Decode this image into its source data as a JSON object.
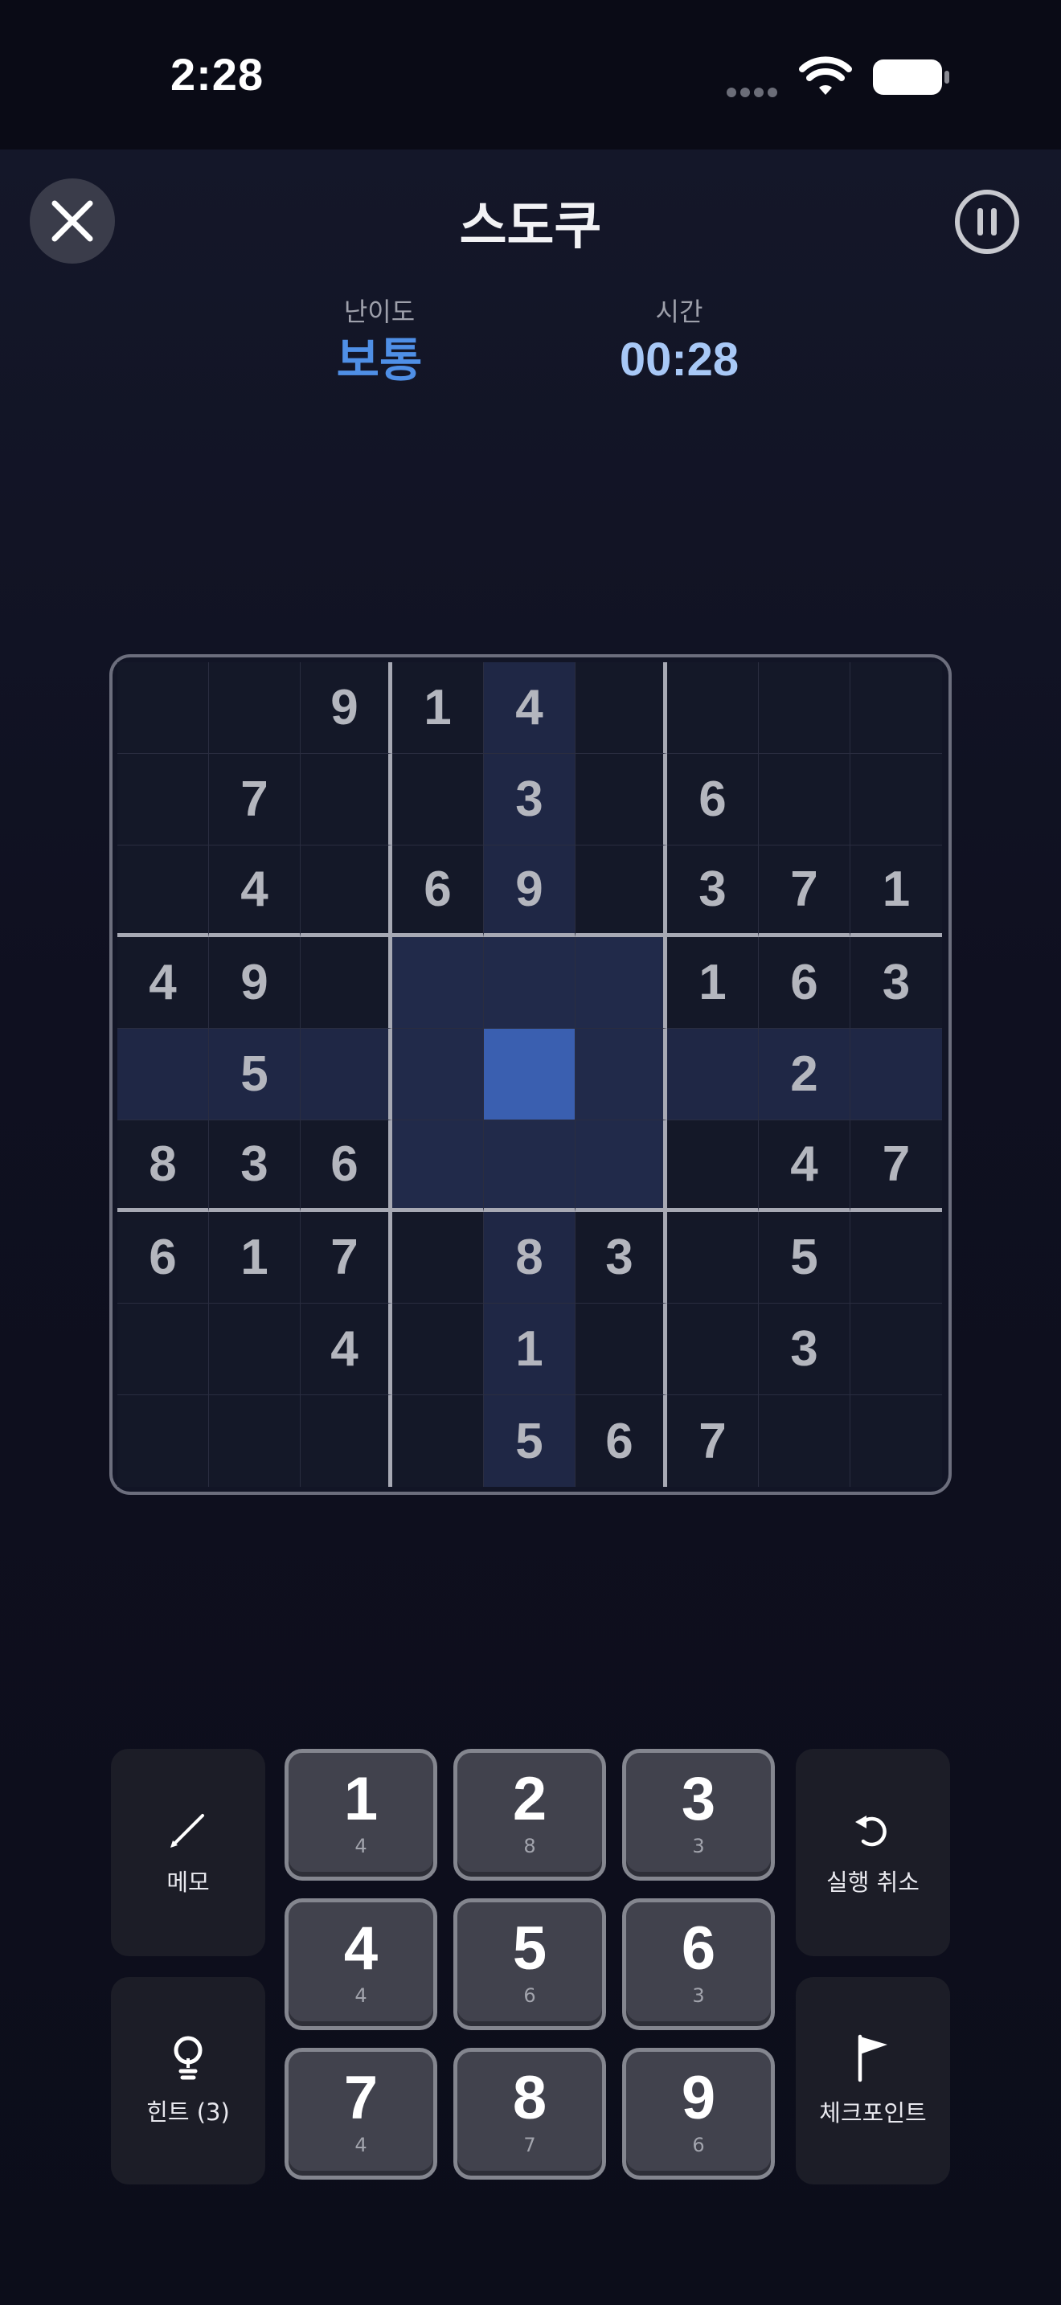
{
  "status_bar": {
    "time": "2:28"
  },
  "header": {
    "title": "스도쿠",
    "close_icon": "close-icon",
    "pause_icon": "pause-icon"
  },
  "info": {
    "difficulty_label": "난이도",
    "difficulty_value": "보통",
    "time_label": "시간",
    "time_value": "00:28"
  },
  "board": {
    "rows": [
      [
        "",
        "",
        "9",
        "1",
        "4",
        "",
        "",
        "",
        ""
      ],
      [
        "",
        "7",
        "",
        "",
        "3",
        "",
        "6",
        "",
        ""
      ],
      [
        "",
        "4",
        "",
        "6",
        "9",
        "",
        "3",
        "7",
        "1"
      ],
      [
        "4",
        "9",
        "",
        "",
        "",
        "",
        "1",
        "6",
        "3"
      ],
      [
        "",
        "5",
        "",
        "",
        "",
        "",
        "",
        "2",
        ""
      ],
      [
        "8",
        "3",
        "6",
        "",
        "",
        "",
        "",
        "4",
        "7"
      ],
      [
        "6",
        "1",
        "7",
        "",
        "8",
        "3",
        "",
        "5",
        ""
      ],
      [
        "",
        "",
        "4",
        "",
        "1",
        "",
        "",
        "3",
        ""
      ],
      [
        "",
        "",
        "",
        "",
        "5",
        "6",
        "7",
        "",
        ""
      ]
    ],
    "selected_row": 4,
    "selected_col": 4
  },
  "controls": {
    "memo_label": "메모",
    "hint_label": "힌트 (3)",
    "undo_label": "실행 취소",
    "checkpoint_label": "체크포인트"
  },
  "numpad": [
    {
      "digit": "1",
      "count": "4"
    },
    {
      "digit": "2",
      "count": "8"
    },
    {
      "digit": "3",
      "count": "3"
    },
    {
      "digit": "4",
      "count": "4"
    },
    {
      "digit": "5",
      "count": "6"
    },
    {
      "digit": "6",
      "count": "3"
    },
    {
      "digit": "7",
      "count": "4"
    },
    {
      "digit": "8",
      "count": "7"
    },
    {
      "digit": "9",
      "count": "6"
    }
  ],
  "colors": {
    "accent": "#4f8fe6",
    "selected_cell": "#3a5fb0",
    "highlight": "#1f2745"
  }
}
